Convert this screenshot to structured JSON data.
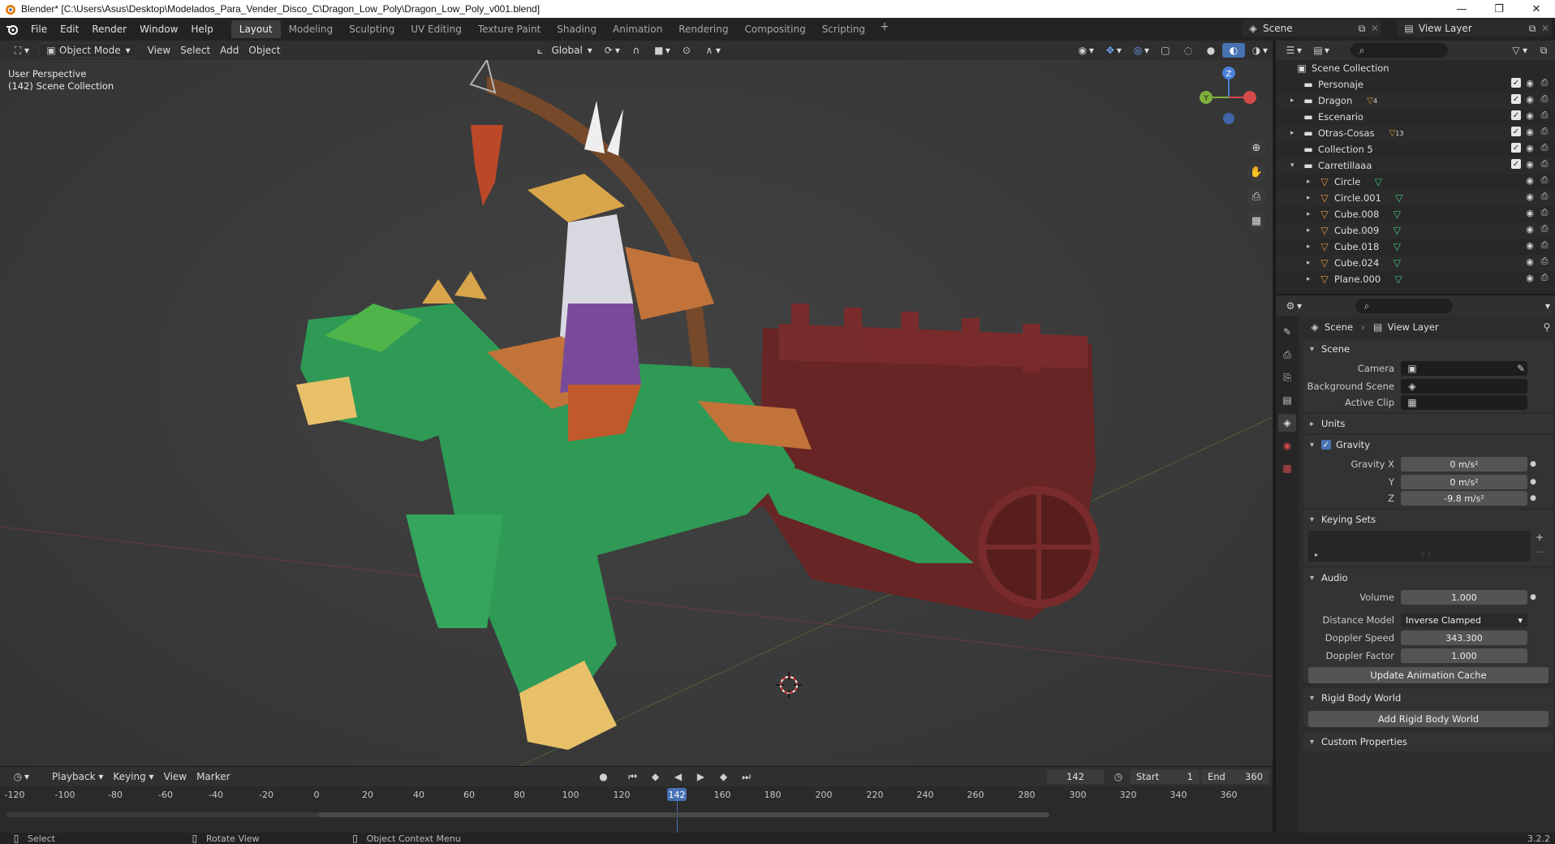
{
  "window": {
    "title": "Blender* [C:\\Users\\Asus\\Desktop\\Modelados_Para_Vender_Disco_C\\Dragon_Low_Poly\\Dragon_Low_Poly_v001.blend]",
    "controls": [
      "—",
      "❐",
      "✕"
    ]
  },
  "menu": [
    "File",
    "Edit",
    "Render",
    "Window",
    "Help"
  ],
  "workspaces": [
    "Layout",
    "Modeling",
    "Sculpting",
    "UV Editing",
    "Texture Paint",
    "Shading",
    "Animation",
    "Rendering",
    "Compositing",
    "Scripting"
  ],
  "active_workspace": "Layout",
  "scene_selector": "Scene",
  "view_layer_selector": "View Layer",
  "viewport_header": {
    "mode": "Object Mode",
    "menus": [
      "View",
      "Select",
      "Add",
      "Object"
    ],
    "orientation": "Global"
  },
  "viewport": {
    "perspective": "User Perspective",
    "collection": "(142) Scene Collection",
    "gizmo_axes": [
      "Z",
      "Y",
      "X"
    ]
  },
  "outliner": {
    "root": "Scene Collection",
    "rows": [
      {
        "name": "Personaje",
        "type": "collection",
        "indent": 0,
        "expand": "",
        "badge": ""
      },
      {
        "name": "Dragon",
        "type": "collection",
        "indent": 0,
        "expand": "▸",
        "badge": "4"
      },
      {
        "name": "Escenario",
        "type": "collection",
        "indent": 0,
        "expand": "",
        "badge": ""
      },
      {
        "name": "Otras-Cosas",
        "type": "collection",
        "indent": 0,
        "expand": "▸",
        "badge": "13"
      },
      {
        "name": "Collection 5",
        "type": "collection",
        "indent": 0,
        "expand": "",
        "badge": ""
      },
      {
        "name": "Carretillaaa",
        "type": "collection",
        "indent": 0,
        "expand": "▾",
        "badge": ""
      },
      {
        "name": "Circle",
        "type": "object",
        "indent": 1,
        "expand": "▸",
        "badge": ""
      },
      {
        "name": "Circle.001",
        "type": "object",
        "indent": 1,
        "expand": "▸",
        "badge": ""
      },
      {
        "name": "Cube.008",
        "type": "object",
        "indent": 1,
        "expand": "▸",
        "badge": ""
      },
      {
        "name": "Cube.009",
        "type": "object",
        "indent": 1,
        "expand": "▸",
        "badge": ""
      },
      {
        "name": "Cube.018",
        "type": "object",
        "indent": 1,
        "expand": "▸",
        "badge": ""
      },
      {
        "name": "Cube.024",
        "type": "object",
        "indent": 1,
        "expand": "▸",
        "badge": ""
      },
      {
        "name": "Plane.000",
        "type": "object",
        "indent": 1,
        "expand": "▸",
        "badge": ""
      }
    ]
  },
  "properties": {
    "breadcrumb": [
      "Scene",
      "View Layer"
    ],
    "scene_panel": {
      "title": "Scene",
      "camera_label": "Camera",
      "background_label": "Background Scene",
      "clip_label": "Active Clip"
    },
    "units_panel": "Units",
    "gravity_panel": {
      "title": "Gravity",
      "x_label": "Gravity X",
      "x": "0 m/s²",
      "y_label": "Y",
      "y": "0 m/s²",
      "z_label": "Z",
      "z": "-9.8 m/s²"
    },
    "keying_sets_panel": "Keying Sets",
    "audio_panel": {
      "title": "Audio",
      "volume_label": "Volume",
      "volume": "1.000",
      "distance_label": "Distance Model",
      "distance": "Inverse Clamped",
      "speed_label": "Doppler Speed",
      "speed": "343.300",
      "factor_label": "Doppler Factor",
      "factor": "1.000"
    },
    "update_cache_button": "Update Animation Cache",
    "rigid_body_panel": "Rigid Body World",
    "add_rigid_button": "Add Rigid Body World",
    "custom_props_panel": "Custom Properties"
  },
  "timeline": {
    "menus": [
      "Playback",
      "Keying",
      "View",
      "Marker"
    ],
    "current_frame": "142",
    "start_label": "Start",
    "start": "1",
    "end_label": "End",
    "end": "360",
    "ticks": [
      "-120",
      "-100",
      "-80",
      "-60",
      "-40",
      "-20",
      "0",
      "20",
      "40",
      "60",
      "80",
      "100",
      "120",
      "142",
      "160",
      "180",
      "200",
      "220",
      "240",
      "260",
      "280",
      "300",
      "320",
      "340",
      "360"
    ]
  },
  "statusbar": {
    "select": "Select",
    "rotate": "Rotate View",
    "context": "Object Context Menu",
    "version": "3.2.2"
  },
  "colors": {
    "accent": "#4772b3",
    "dragon_green": "#2e9a55",
    "cart_red": "#6e2323",
    "background": "#3b3b3b"
  }
}
